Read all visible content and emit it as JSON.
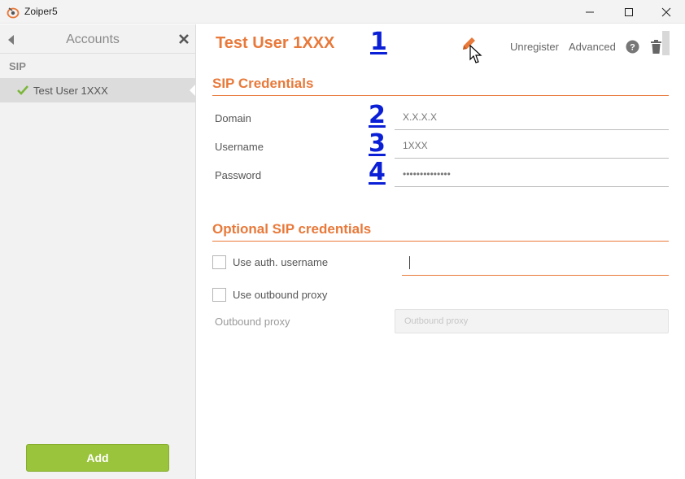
{
  "window": {
    "title": "Zoiper5"
  },
  "sidebar": {
    "title": "Accounts",
    "section": "SIP",
    "accounts": [
      {
        "name": "Test User 1XXX",
        "status": "registered"
      }
    ],
    "add_label": "Add"
  },
  "account": {
    "title": "Test User 1XXX",
    "actions": {
      "unregister": "Unregister",
      "advanced": "Advanced"
    }
  },
  "markers": [
    "1",
    "2",
    "3",
    "4"
  ],
  "sip_credentials": {
    "title": "SIP Credentials",
    "fields": [
      {
        "label": "Domain",
        "value": "X.X.X.X"
      },
      {
        "label": "Username",
        "value": "1XXX"
      },
      {
        "label": "Password",
        "value": "••••••••••••••"
      }
    ]
  },
  "optional_credentials": {
    "title": "Optional SIP credentials",
    "use_auth_username": {
      "label": "Use auth. username",
      "checked": false,
      "value": ""
    },
    "use_outbound_proxy": {
      "label": "Use outbound proxy",
      "checked": false
    },
    "outbound_proxy": {
      "label": "Outbound proxy",
      "placeholder": "Outbound proxy"
    }
  },
  "colors": {
    "accent": "#e8793a",
    "add_button": "#9ac43b",
    "marker": "#0a1fd6"
  }
}
